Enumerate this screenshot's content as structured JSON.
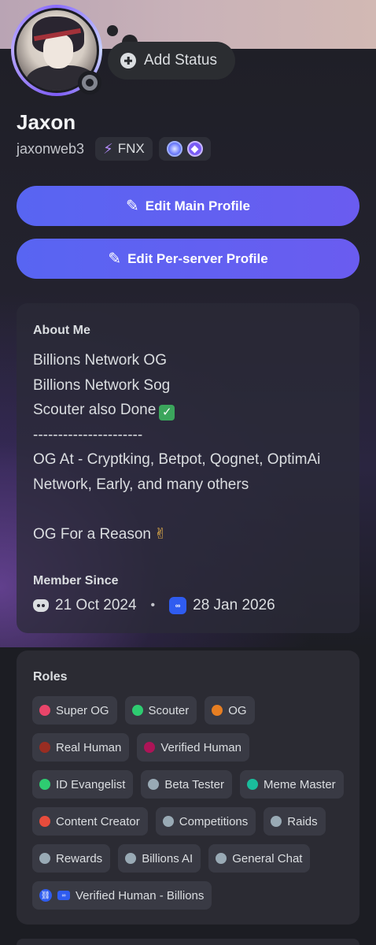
{
  "profile": {
    "display_name": "Jaxon",
    "username": "jaxonweb3",
    "tag": "FNX",
    "add_status_label": "Add Status"
  },
  "buttons": {
    "edit_main": "Edit Main Profile",
    "edit_server": "Edit Per-server Profile"
  },
  "about": {
    "title": "About Me",
    "lines": [
      "Billions Network OG",
      "Billions Network Sog",
      "Scouter also Done",
      "----------------------",
      "OG At - Cryptking, Betpot, Qognet, OptimAi Network, Early, and many others",
      "",
      "OG For a Reason"
    ]
  },
  "member_since": {
    "title": "Member Since",
    "discord_date": "21 Oct 2024",
    "separator": "•",
    "server_date": "28 Jan 2026"
  },
  "roles": {
    "title": "Roles",
    "items": [
      {
        "label": "Super OG",
        "color": "#e9456a"
      },
      {
        "label": "Scouter",
        "color": "#2ecc71"
      },
      {
        "label": "OG",
        "color": "#e67e22"
      },
      {
        "label": "Real Human",
        "color": "#992d22"
      },
      {
        "label": "Verified Human",
        "color": "#ad1457"
      },
      {
        "label": "ID Evangelist",
        "color": "#2ecc71"
      },
      {
        "label": "Beta Tester",
        "color": "#99aab5"
      },
      {
        "label": "Meme Master",
        "color": "#1abc9c"
      },
      {
        "label": "Content Creator",
        "color": "#e74c3c"
      },
      {
        "label": "Competitions",
        "color": "#99aab5"
      },
      {
        "label": "Raids",
        "color": "#99aab5"
      },
      {
        "label": "Rewards",
        "color": "#99aab5"
      },
      {
        "label": "Billions AI",
        "color": "#99aab5"
      },
      {
        "label": "General Chat",
        "color": "#99aab5"
      },
      {
        "label": "Verified Human - Billions",
        "color": "#2f5cf0",
        "icon": "link-icon"
      }
    ]
  },
  "colors": {
    "accent": "#5865f2",
    "background": "#1c1d23",
    "card": "#2b2b33"
  }
}
